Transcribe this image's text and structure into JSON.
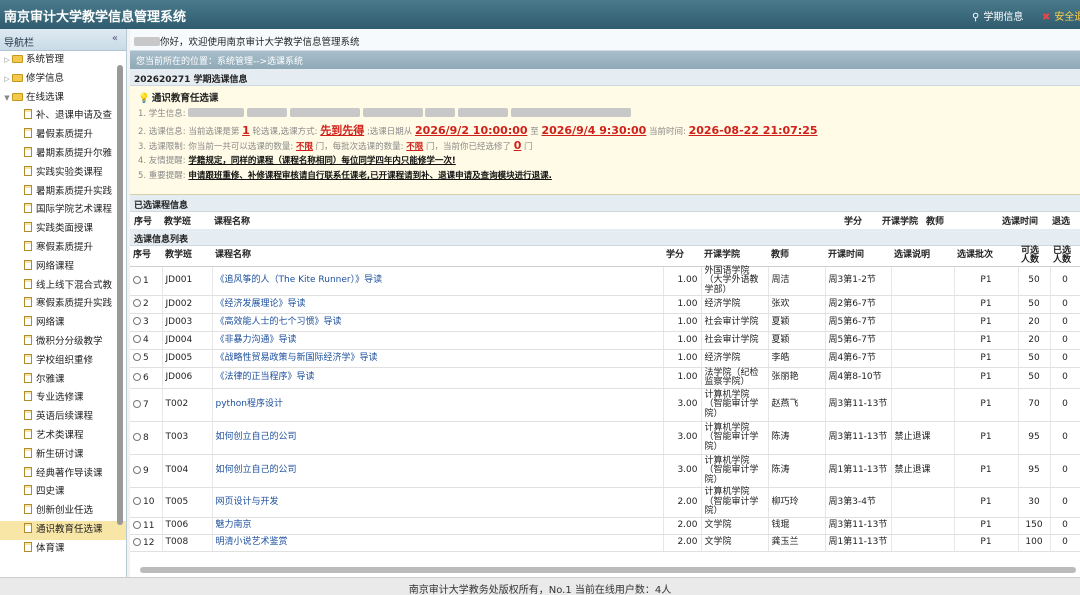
{
  "app": {
    "title": "南京审计大学教学信息管理系统",
    "term_link": "学期信息",
    "safe_link": "安全退出"
  },
  "sidebar": {
    "header": "导航栏",
    "collapse_icon": "«",
    "items": [
      {
        "label": "系统管理",
        "level": 0
      },
      {
        "label": "修学信息",
        "level": 0
      },
      {
        "label": "在线选课",
        "level": 0
      },
      {
        "label": "补、退课申请及查",
        "level": 1
      },
      {
        "label": "暑假素质提升",
        "level": 1
      },
      {
        "label": "暑期素质提升尔雅",
        "level": 1
      },
      {
        "label": "实践实验类课程",
        "level": 1
      },
      {
        "label": "暑期素质提升实践",
        "level": 1
      },
      {
        "label": "国际学院艺术课程",
        "level": 1
      },
      {
        "label": "实践类面授课",
        "level": 1
      },
      {
        "label": "寒假素质提升",
        "level": 1
      },
      {
        "label": "网络课程",
        "level": 1
      },
      {
        "label": "线上线下混合式教",
        "level": 1
      },
      {
        "label": "寒假素质提升实践",
        "level": 1
      },
      {
        "label": "网络课",
        "level": 1
      },
      {
        "label": "微积分分级教学",
        "level": 1
      },
      {
        "label": "学校组织重修",
        "level": 1
      },
      {
        "label": "尔雅课",
        "level": 1
      },
      {
        "label": "专业选修课",
        "level": 1
      },
      {
        "label": "英语后续课程",
        "level": 1
      },
      {
        "label": "艺术类课程",
        "level": 1
      },
      {
        "label": "新生研讨课",
        "level": 1
      },
      {
        "label": "经典著作导读课",
        "level": 1
      },
      {
        "label": "四史课",
        "level": 1
      },
      {
        "label": "创新创业任选",
        "level": 1
      },
      {
        "label": "通识教育任选课",
        "level": 1,
        "active": true
      },
      {
        "label": "体育课",
        "level": 1
      }
    ]
  },
  "main": {
    "welcome_suffix": "你好，欢迎使用南京审计大学教学信息管理系统",
    "location": "您当前所在的位置：系统管理-->选课系统",
    "term_title": "202620271 学期选课信息",
    "notice": {
      "title": "通识教育任选课",
      "l1_label": "1. 学生信息:",
      "l2_a": "2. 选课信息: 当前选课是第",
      "l2_round": "1",
      "l2_b": "轮选课,选课方式:",
      "l2_mode": "先到先得",
      "l2_c": ";选课日期从",
      "l2_start": "2026/9/2 10:00:00",
      "l2_d": "至",
      "l2_end": "2026/9/4 9:30:00",
      "l2_e": "当前时间:",
      "l2_now": "2026-08-22 21:07:25",
      "l3_a": "3. 选课限制: 你当前一共可以选课的数量:",
      "l3_limit1": "不限",
      "l3_b": "门，每批次选课的数量:",
      "l3_limit2": "不限",
      "l3_c": "门，当前你已经选修了",
      "l3_count": "0",
      "l3_d": "门",
      "l4_a": "4. 友情提醒:",
      "l4_b": "学籍规定，同样的课程（课程名称相同）每位同学四年内只能修学一次!",
      "l5_a": "5. 重要提醒:",
      "l5_b": "申请跟班重修、补修课程审核请自行联系任课老,已开课程请到补、退课申请及查询模块进行退课."
    },
    "selected_title": "已选课程信息",
    "selected_headers": [
      "序号",
      "教学班",
      "课程名称",
      "学分",
      "开课学院",
      "教师",
      "选课时间",
      "退选"
    ],
    "list_title": "选课信息列表",
    "list_headers": [
      "序号",
      "教学班",
      "课程名称",
      "学分",
      "开课学院",
      "教师",
      "开课时间",
      "选课说明",
      "选课批次",
      "可选人数",
      "已选人数"
    ],
    "courses": [
      {
        "no": "1",
        "cls": "JD001",
        "name": "《追风筝的人（The Kite Runner）》导读",
        "credit": "1.00",
        "college": "外国语学院（大学外语教学部）",
        "teacher": "周洁",
        "time": "周3第1-2节",
        "note": "",
        "batch": "P1",
        "cap": "50",
        "sel": "0"
      },
      {
        "no": "2",
        "cls": "JD002",
        "name": "《经济发展理论》导读",
        "credit": "1.00",
        "college": "经济学院",
        "teacher": "张欢",
        "time": "周2第6-7节",
        "note": "",
        "batch": "P1",
        "cap": "50",
        "sel": "0"
      },
      {
        "no": "3",
        "cls": "JD003",
        "name": "《高效能人士的七个习惯》导读",
        "credit": "1.00",
        "college": "社会审计学院",
        "teacher": "夏颖",
        "time": "周5第6-7节",
        "note": "",
        "batch": "P1",
        "cap": "20",
        "sel": "0"
      },
      {
        "no": "4",
        "cls": "JD004",
        "name": "《非暴力沟通》导读",
        "credit": "1.00",
        "college": "社会审计学院",
        "teacher": "夏颖",
        "time": "周5第6-7节",
        "note": "",
        "batch": "P1",
        "cap": "20",
        "sel": "0"
      },
      {
        "no": "5",
        "cls": "JD005",
        "name": "《战略性贸易政策与新国际经济学》导读",
        "credit": "1.00",
        "college": "经济学院",
        "teacher": "李皓",
        "time": "周4第6-7节",
        "note": "",
        "batch": "P1",
        "cap": "50",
        "sel": "0"
      },
      {
        "no": "6",
        "cls": "JD006",
        "name": "《法律的正当程序》导读",
        "credit": "1.00",
        "college": "法学院（纪检监察学院）",
        "teacher": "张丽艳",
        "time": "周4第8-10节",
        "note": "",
        "batch": "P1",
        "cap": "50",
        "sel": "0"
      },
      {
        "no": "7",
        "cls": "T002",
        "name": "python程序设计",
        "credit": "3.00",
        "college": "计算机学院（智能审计学院）",
        "teacher": "赵燕飞",
        "time": "周3第11-13节",
        "note": "",
        "batch": "P1",
        "cap": "70",
        "sel": "0"
      },
      {
        "no": "8",
        "cls": "T003",
        "name": "如何创立自己的公司",
        "credit": "3.00",
        "college": "计算机学院（智能审计学院）",
        "teacher": "陈涛",
        "time": "周3第11-13节",
        "note": "禁止退课",
        "batch": "P1",
        "cap": "95",
        "sel": "0"
      },
      {
        "no": "9",
        "cls": "T004",
        "name": "如何创立自己的公司",
        "credit": "3.00",
        "college": "计算机学院（智能审计学院）",
        "teacher": "陈涛",
        "time": "周1第11-13节",
        "note": "禁止退课",
        "batch": "P1",
        "cap": "95",
        "sel": "0"
      },
      {
        "no": "10",
        "cls": "T005",
        "name": "网页设计与开发",
        "credit": "2.00",
        "college": "计算机学院（智能审计学院）",
        "teacher": "柳巧玲",
        "time": "周3第3-4节",
        "note": "",
        "batch": "P1",
        "cap": "30",
        "sel": "0"
      },
      {
        "no": "11",
        "cls": "T006",
        "name": "魅力南京",
        "credit": "2.00",
        "college": "文学院",
        "teacher": "钱琨",
        "time": "周3第11-13节",
        "note": "",
        "batch": "P1",
        "cap": "150",
        "sel": "0"
      },
      {
        "no": "12",
        "cls": "T008",
        "name": "明清小说艺术鉴赏",
        "credit": "2.00",
        "college": "文学院",
        "teacher": "龚玉兰",
        "time": "周1第11-13节",
        "note": "",
        "batch": "P1",
        "cap": "100",
        "sel": "0"
      }
    ]
  },
  "footer": "南京审计大学教务处版权所有，No.1 当前在线用户数：4人"
}
